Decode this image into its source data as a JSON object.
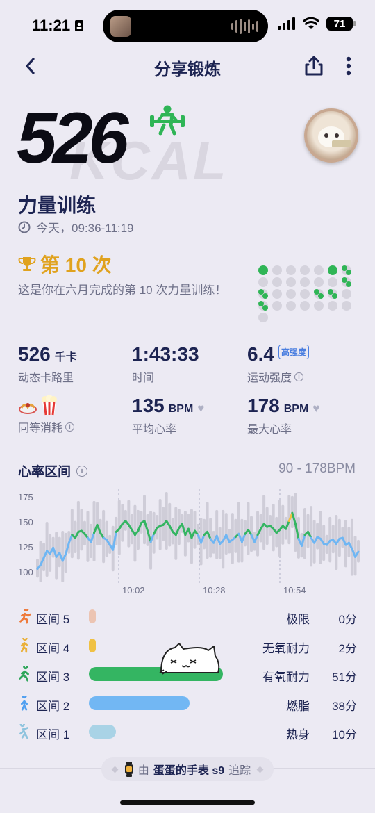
{
  "status_bar": {
    "time": "11:21",
    "battery": "71"
  },
  "nav": {
    "title": "分享锻炼"
  },
  "hero": {
    "calories": "526",
    "unit_watermark": "KCAL"
  },
  "workout": {
    "title": "力量训练",
    "time_range": "今天，09:36-11:19",
    "achievement": "第 10 次",
    "achievement_desc": "这是你在六月完成的第 10 次力量训练！"
  },
  "stats": {
    "calories": {
      "value": "526",
      "unit": "千卡",
      "label": "动态卡路里"
    },
    "duration": {
      "value": "1:43:33",
      "label": "时间"
    },
    "intensity": {
      "value": "6.4",
      "badge": "高强度",
      "label": "运动强度"
    },
    "equivalent": {
      "label": "同等消耗",
      "icons": [
        "spaghetti",
        "popcorn"
      ]
    },
    "avg_hr": {
      "value": "135",
      "unit": "BPM",
      "label": "平均心率"
    },
    "max_hr": {
      "value": "178",
      "unit": "BPM",
      "label": "最大心率"
    }
  },
  "heart_rate": {
    "title": "心率区间",
    "range": "90 - 178BPM"
  },
  "chart_data": {
    "type": "line",
    "title": "",
    "xlabel": "",
    "ylabel": "",
    "y_ticks": [
      "175",
      "150",
      "125",
      "100"
    ],
    "x_ticks": [
      "10:02",
      "10:28",
      "10:54"
    ],
    "ylim": [
      95,
      180
    ],
    "series": [
      {
        "values": [
          103,
          107,
          114,
          121,
          118,
          124,
          115,
          119,
          111,
          118,
          129,
          137,
          134,
          140,
          141,
          138,
          134,
          130,
          139,
          147,
          139,
          134,
          132,
          127,
          122,
          140,
          143,
          148,
          151,
          147,
          142,
          137,
          141,
          149,
          151,
          141,
          130,
          138,
          144,
          146,
          147,
          151,
          146,
          140,
          137,
          144,
          148,
          137,
          143,
          134,
          141,
          137,
          129,
          137,
          140,
          133,
          129,
          136,
          128,
          131,
          137,
          130,
          132,
          135,
          138,
          130,
          138,
          142,
          137,
          130,
          137,
          143,
          148,
          145,
          146,
          143,
          139,
          142,
          146,
          143,
          151,
          159,
          148,
          133,
          126,
          137,
          140,
          134,
          129,
          135,
          133,
          128,
          127,
          131,
          132,
          128,
          133,
          134,
          127,
          129,
          123,
          115,
          120
        ]
      }
    ],
    "zone_colors": {
      "zone1": "#a9d3e6",
      "zone2": "#6fb6f3",
      "zone3": "#34b562",
      "zone4": "#f0c143",
      "zone5": "#e99b82"
    }
  },
  "zones": [
    {
      "name": "区间 5",
      "desc": "极限",
      "minutes": "0分",
      "fraction": 0.0,
      "color": "#ecc4b2",
      "icon": "sprint-icon",
      "icon_color": "#ee7a3b"
    },
    {
      "name": "区间 4",
      "desc": "无氧耐力",
      "minutes": "2分",
      "fraction": 0.04,
      "color": "#f0c143",
      "icon": "run-icon",
      "icon_color": "#eab13b"
    },
    {
      "name": "区间 3",
      "desc": "有氧耐力",
      "minutes": "51分",
      "fraction": 1.0,
      "color": "#34b562",
      "icon": "jog-icon",
      "icon_color": "#2fa65a"
    },
    {
      "name": "区间 2",
      "desc": "燃脂",
      "minutes": "38分",
      "fraction": 0.75,
      "color": "#72b7f3",
      "icon": "walk-icon",
      "icon_color": "#4f9ff0"
    },
    {
      "name": "区间 1",
      "desc": "热身",
      "minutes": "10分",
      "fraction": 0.2,
      "color": "#a9d3e6",
      "icon": "stretch-icon",
      "icon_color": "#8fc4de"
    }
  ],
  "footer": {
    "prefix": "由",
    "device": "蛋蛋的手表 s9",
    "suffix": "追踪"
  }
}
